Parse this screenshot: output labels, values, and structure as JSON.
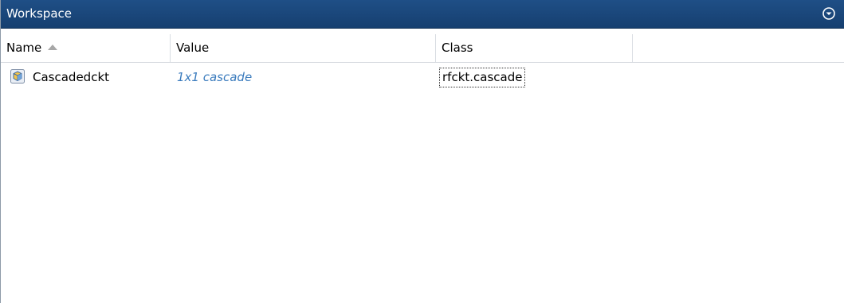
{
  "panel": {
    "title": "Workspace",
    "action_icon": "dropdown-circle-icon"
  },
  "table": {
    "columns": [
      {
        "label": "Name",
        "sorted": "ascending",
        "sort_icon": "sort-ascending-icon"
      },
      {
        "label": "Value"
      },
      {
        "label": "Class"
      },
      {
        "label": ""
      }
    ],
    "rows": [
      {
        "icon": "object-variable-icon",
        "name": "Cascadedckt",
        "value": "1x1 cascade",
        "class": "rfckt.cascade"
      }
    ]
  },
  "colors": {
    "titlebar": "#1f4f86",
    "value_link": "#3a7bbd"
  }
}
